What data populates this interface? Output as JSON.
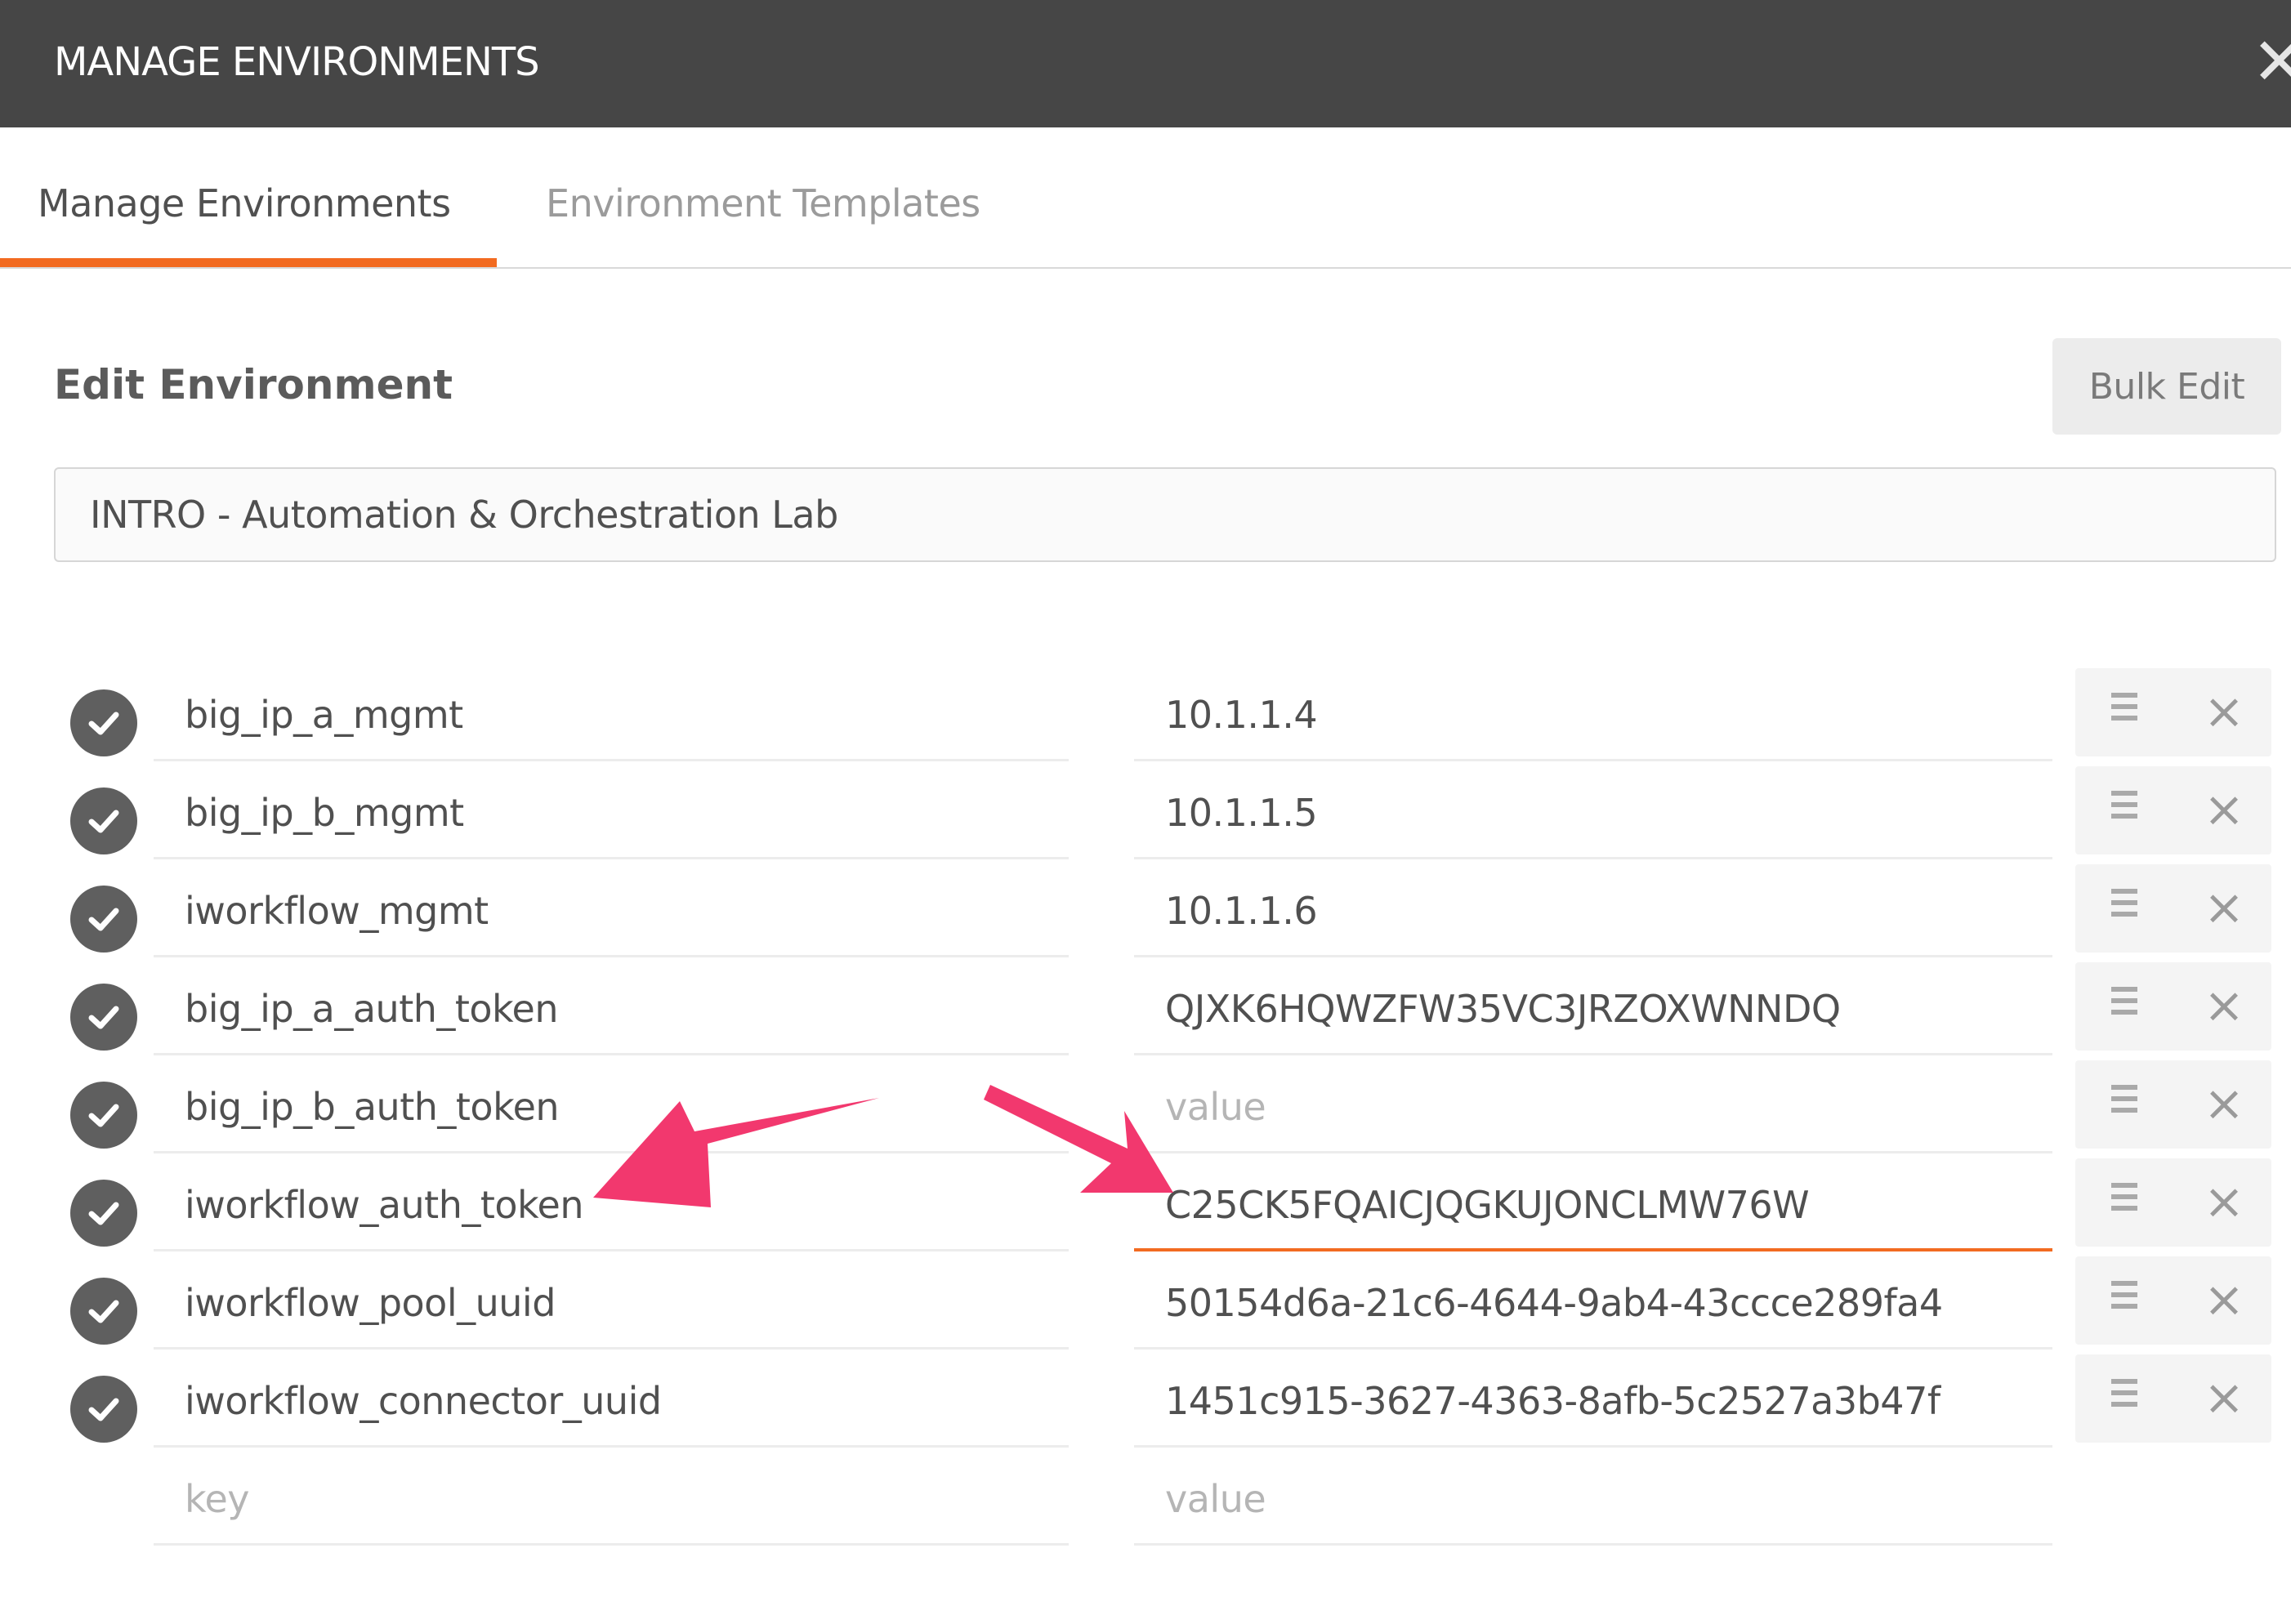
{
  "window": {
    "title": "MANAGE ENVIRONMENTS",
    "close_glyph": "✕"
  },
  "tabs": [
    {
      "label": "Manage Environments",
      "active": true
    },
    {
      "label": "Environment Templates",
      "active": false
    }
  ],
  "editor": {
    "section_title": "Edit Environment",
    "bulk_edit_label": "Bulk Edit",
    "environment_name": "INTRO - Automation & Orchestration Lab"
  },
  "variables": [
    {
      "key": "big_ip_a_mgmt",
      "value": "10.1.1.4",
      "enabled": true
    },
    {
      "key": "big_ip_b_mgmt",
      "value": "10.1.1.5",
      "enabled": true
    },
    {
      "key": "iworkflow_mgmt",
      "value": "10.1.1.6",
      "enabled": true
    },
    {
      "key": "big_ip_a_auth_token",
      "value": "QJXK6HQWZFW35VC3JRZOXWNNDQ",
      "enabled": true
    },
    {
      "key": "big_ip_b_auth_token",
      "value": "",
      "enabled": true
    },
    {
      "key": "iworkflow_auth_token",
      "value": "C25CK5FQAICJQGKUJONCLMW76W",
      "enabled": true,
      "focused": true
    },
    {
      "key": "iworkflow_pool_uuid",
      "value": "50154d6a-21c6-4644-9ab4-43ccce289fa4",
      "enabled": true
    },
    {
      "key": "iworkflow_connector_uuid",
      "value": "1451c915-3627-4363-8afb-5c2527a3b47f",
      "enabled": true
    }
  ],
  "new_row": {
    "key_placeholder": "key",
    "value_placeholder": "value"
  },
  "icons": {
    "row_toggle": "check-circle-icon",
    "row_drag": "drag-handle-icon",
    "row_delete": "delete-icon",
    "delete_glyph": "×"
  },
  "colors": {
    "titlebar": "#464646",
    "accent": "#f26b21",
    "annotation_arrow": "#f2386e"
  }
}
